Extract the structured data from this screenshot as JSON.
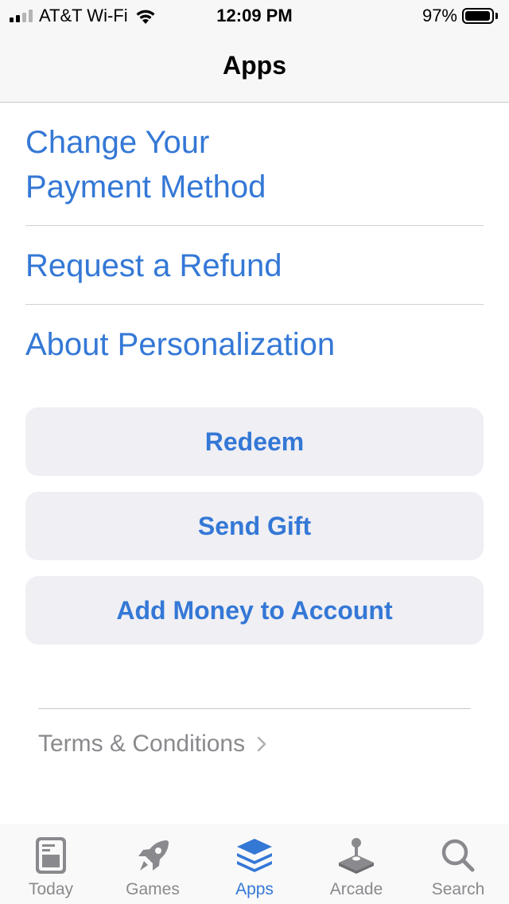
{
  "status_bar": {
    "carrier": "AT&T Wi-Fi",
    "time": "12:09 PM",
    "battery_percent": "97%",
    "battery_level": 0.97,
    "signal_bars_filled": 2,
    "signal_bars_total": 4
  },
  "nav": {
    "title": "Apps"
  },
  "links": {
    "change_payment_line1": "Change Your",
    "change_payment_line2": "Payment Method",
    "request_refund": "Request a Refund",
    "about_personalization": "About Personalization"
  },
  "buttons": {
    "redeem": "Redeem",
    "send_gift": "Send Gift",
    "add_money": "Add Money to Account"
  },
  "footer": {
    "terms": "Terms & Conditions"
  },
  "tab_bar": {
    "tabs": [
      {
        "label": "Today",
        "icon": "today-icon",
        "active": false
      },
      {
        "label": "Games",
        "icon": "rocket-icon",
        "active": false
      },
      {
        "label": "Apps",
        "icon": "layers-icon",
        "active": true
      },
      {
        "label": "Arcade",
        "icon": "joystick-icon",
        "active": false
      },
      {
        "label": "Search",
        "icon": "search-icon",
        "active": false
      }
    ]
  },
  "colors": {
    "accent": "#3478d6",
    "inactive": "#8a8a8e",
    "button_bg": "#efeff4"
  }
}
